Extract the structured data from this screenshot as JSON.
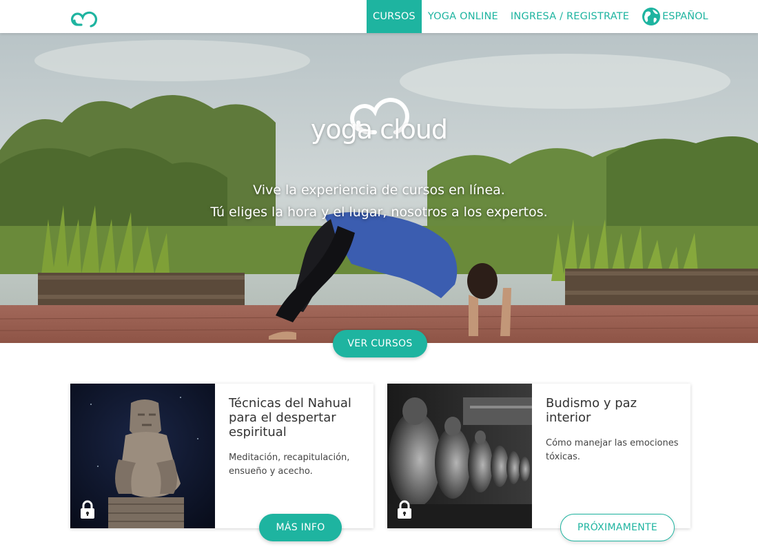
{
  "nav": {
    "links": [
      {
        "label": "CURSOS",
        "active": true
      },
      {
        "label": "YOGA ONLINE",
        "active": false
      },
      {
        "label": "INGRESA / REGISTRATE",
        "active": false
      }
    ],
    "language": "ESPAÑOL",
    "logo_icon": "cloud-logo-icon",
    "language_icon": "globe-icon"
  },
  "hero": {
    "brand": "yoga cloud",
    "tagline_1": "Vive la experiencia de cursos en línea.",
    "tagline_2": "Tú eliges la hora y el lugar, nosotros a los expertos.",
    "cta": "VER CURSOS"
  },
  "courses": [
    {
      "title": "Técnicas del Nahual para el despertar espiritual",
      "description": "Meditación, recapitulación, ensueño y acecho.",
      "button": "MÁS INFO",
      "locked": true
    },
    {
      "title": "Budismo y paz interior",
      "description": "Cómo manejar las emociones tóxicas.",
      "button": "PRÓXIMAMENTE",
      "locked": true
    }
  ],
  "colors": {
    "accent": "#1eb4a0",
    "white": "#ffffff"
  }
}
